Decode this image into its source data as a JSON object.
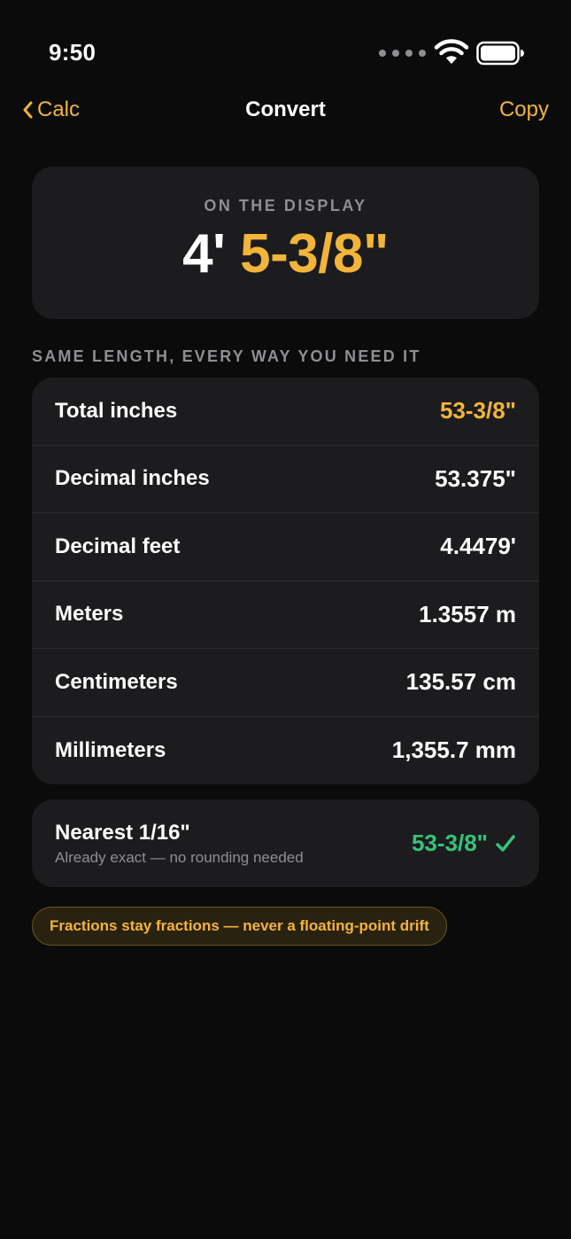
{
  "status_bar": {
    "time": "9:50",
    "icons": [
      "signal-dots-icon",
      "wifi-icon",
      "battery-icon"
    ]
  },
  "nav": {
    "back_label": "Calc",
    "title": "Convert",
    "action_label": "Copy"
  },
  "display": {
    "label": "ON THE DISPLAY",
    "feet": "4'",
    "inches": "5-3/8\""
  },
  "section_header": "SAME LENGTH, EVERY WAY YOU NEED IT",
  "conversions": [
    {
      "label": "Total inches",
      "value": "53-3/8\""
    },
    {
      "label": "Decimal inches",
      "value": "53.375\""
    },
    {
      "label": "Decimal feet",
      "value": "4.4479'"
    },
    {
      "label": "Meters",
      "value": "1.3557 m"
    },
    {
      "label": "Centimeters",
      "value": "135.57 cm"
    },
    {
      "label": "Millimeters",
      "value": "1,355.7 mm"
    }
  ],
  "nearest": {
    "title": "Nearest 1/16\"",
    "subtitle": "Already exact — no rounding needed",
    "value": "53-3/8\""
  },
  "pill": "Fractions stay fractions — never a floating-point drift",
  "colors": {
    "background": "#0b0b0b",
    "card": "#1c1c1e",
    "accent": "#f2b43a",
    "success": "#34c47a",
    "muted": "#8e8e93"
  }
}
